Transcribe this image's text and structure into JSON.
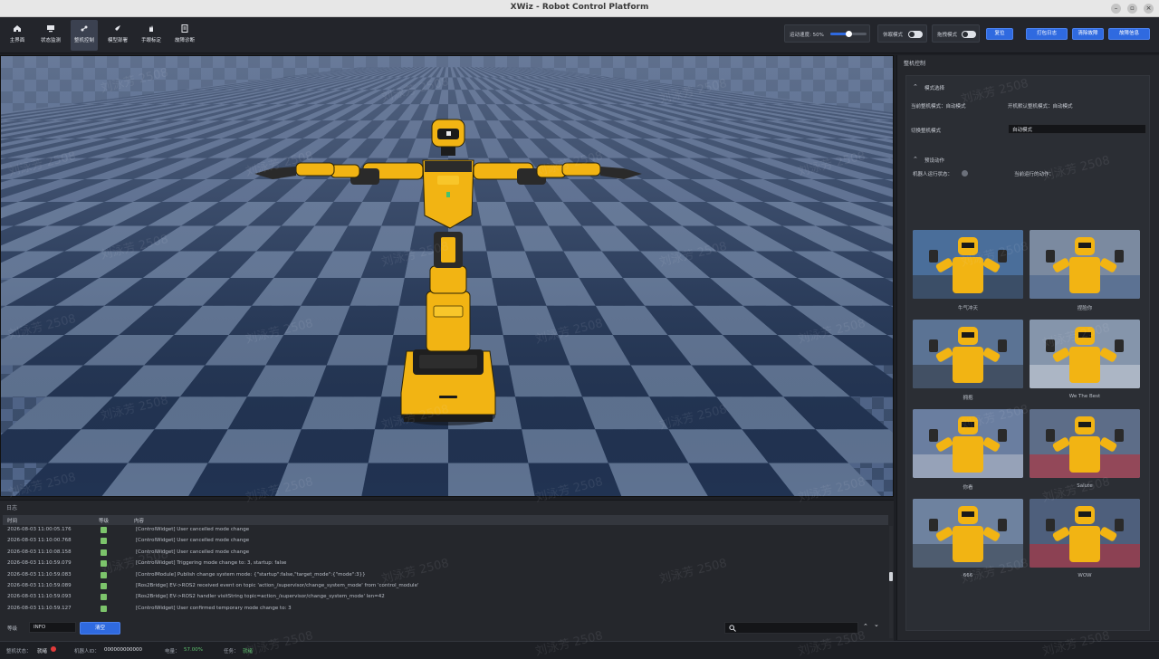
{
  "window": {
    "title": "XWiz - Robot Control Platform",
    "controls": [
      "–",
      "▫",
      "×"
    ]
  },
  "toolbar": {
    "items": [
      {
        "label": "主界面",
        "icon": "home-icon"
      },
      {
        "label": "状态监测",
        "icon": "monitor-icon"
      },
      {
        "label": "整机控制",
        "icon": "control-icon"
      },
      {
        "label": "模型部署",
        "icon": "rocket-icon"
      },
      {
        "label": "手眼标定",
        "icon": "hand-icon"
      },
      {
        "label": "故障诊断",
        "icon": "diagnosis-icon"
      }
    ],
    "speed_label": "运动速度: 50%",
    "speed_value": 0.5,
    "mode_label": "休眠模式",
    "drag_label": "拖拽模式",
    "reset_label": "复位",
    "print_log_label": "打包日志",
    "clear_fault_label": "清除故障",
    "fault_code_label": "故障信息"
  },
  "log": {
    "title": "日志",
    "columns": [
      "时间",
      "等级",
      "内容"
    ],
    "rows": [
      {
        "time": "2026-08-03 11:00:05.176",
        "msg": "[ControlWidget] User cancelled mode change"
      },
      {
        "time": "2026-08-03 11:10:00.768",
        "msg": "[ControlWidget] User cancelled mode change"
      },
      {
        "time": "2026-08-03 11:10:08.158",
        "msg": "[ControlWidget] User cancelled mode change"
      },
      {
        "time": "2026-08-03 11:10:59.079",
        "msg": "[ControlWidget] Triggering mode change to: 3, startup: false"
      },
      {
        "time": "2026-08-03 11:10:59.083",
        "msg": "[ControlModule] Publish change system mode: {\"startup\":false,\"target_mode\":{\"mode\":3}}"
      },
      {
        "time": "2026-08-03 11:10:59.089",
        "msg": "[Ros2Bridge] EV->ROS2 received event on topic 'action_/supervisor/change_system_mode' from 'control_module'"
      },
      {
        "time": "2026-08-03 11:10:59.093",
        "msg": "[Ros2Bridge] EV->ROS2 handler visitString topic=action_/supervisor/change_system_mode' len=42"
      },
      {
        "time": "2026-08-03 11:10:59.127",
        "msg": "[ControlWidget] User confirmed temporary mode change to: 3"
      }
    ],
    "level_label": "等级",
    "level_value": "INFO",
    "clear_label": "清空"
  },
  "status": {
    "robot_state_label": "整机状态：",
    "robot_state": "就绪",
    "robot_id_label": "机器人ID：",
    "robot_id": "000000000000",
    "battery_label": "电量：",
    "battery": "57.00%",
    "task_label": "任务：",
    "task": "就绪"
  },
  "right": {
    "title": "整机控制",
    "mode_section": "模式选择",
    "current_mode_label": "当前整机模式：自动模式",
    "default_mode_label": "开机默认整机模式：自动模式",
    "switch_mode_label": "切换整机模式",
    "switch_mode_value": "自动模式",
    "preset_section": "预设动作",
    "robot_state_label": "机器人运行状态：",
    "current_action_label": "当前运行的动作：",
    "actions": [
      "牛气冲天",
      "捏脸你",
      "拥抱",
      "We The Best",
      "你看",
      "Salute",
      "666",
      "WOW"
    ]
  },
  "watermark": "刘泳芳 2508",
  "colors": {
    "accent": "#2f6ae0",
    "robot_yellow": "#f2b413",
    "floor_light": "#5f7392",
    "floor_dark": "#213352"
  }
}
